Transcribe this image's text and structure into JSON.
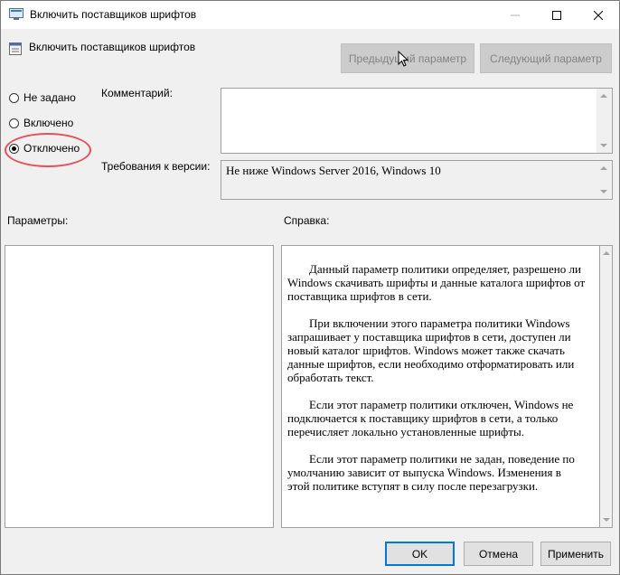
{
  "window": {
    "title": "Включить поставщиков шрифтов"
  },
  "header": {
    "title": "Включить поставщиков шрифтов"
  },
  "nav": {
    "prev_label": "Предыдущий параметр",
    "next_label": "Следующий параметр"
  },
  "state": {
    "options": [
      {
        "label": "Не задано",
        "checked": false
      },
      {
        "label": "Включено",
        "checked": false
      },
      {
        "label": "Отключено",
        "checked": true
      }
    ]
  },
  "comment": {
    "label": "Комментарий:",
    "value": ""
  },
  "requirements": {
    "label": "Требования к версии:",
    "value": "Не ниже Windows Server 2016, Windows 10"
  },
  "params": {
    "label": "Параметры:"
  },
  "help": {
    "label": "Справка:",
    "paragraphs": [
      "Данный параметр политики определяет, разрешено ли Windows скачивать шрифты и данные каталога шрифтов от поставщика шрифтов в сети.",
      "При включении этого параметра политики Windows запрашивает у поставщика шрифтов в сети, доступен ли новый каталог шрифтов. Windows может также скачать данные шрифтов, если необходимо отформатировать или обработать текст.",
      "Если этот параметр политики отключен, Windows не подключается к поставщику шрифтов в сети, а только перечисляет локально установленные шрифты.",
      "Если этот параметр политики не задан, поведение по умолчанию зависит от выпуска Windows. Изменения в этой политике вступят в силу после перезагрузки."
    ]
  },
  "footer": {
    "ok_label": "OK",
    "cancel_label": "Отмена",
    "apply_label": "Применить"
  },
  "colors": {
    "accent": "#0078d7",
    "highlight": "#e4505a"
  }
}
